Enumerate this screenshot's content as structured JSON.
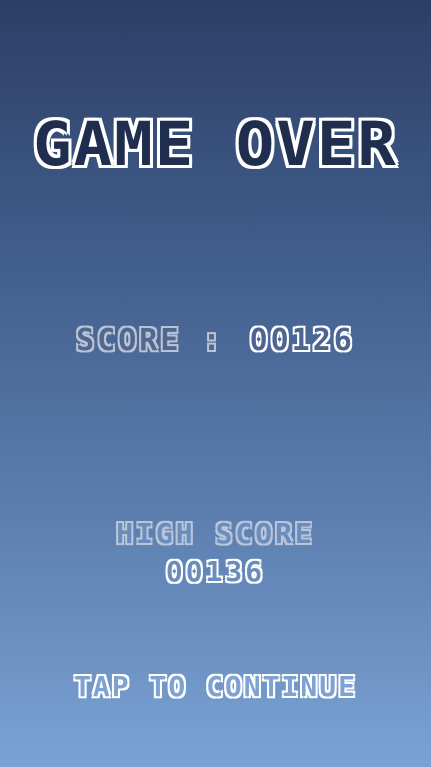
{
  "game": {
    "title": "GAME OVER",
    "score_label": "SCORE :",
    "score_value": "00126",
    "high_score_label": "HIGH SCORE",
    "high_score_value": "00136",
    "continue_prompt": "TAP TO CONTINUE"
  },
  "colors": {
    "background_top": "#2c3f66",
    "background_bottom": "#7aa3d3",
    "text_outline": "#ffffff",
    "label_outline": "#b8c3d6"
  }
}
